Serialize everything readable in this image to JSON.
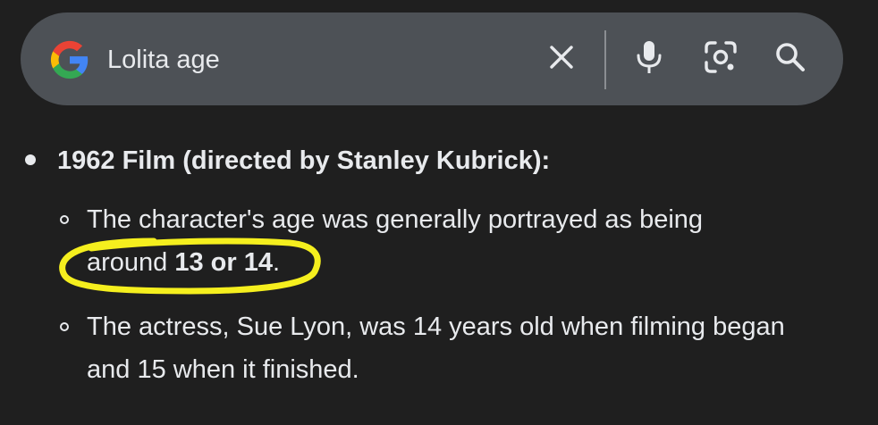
{
  "search": {
    "query": "Lolita age",
    "icons": {
      "logo": "google-g-logo",
      "clear": "close-icon",
      "voice": "microphone-icon",
      "lens": "camera-lens-icon",
      "submit": "search-icon"
    }
  },
  "result": {
    "heading": "1962 Film (directed by Stanley Kubrick):",
    "items": [
      {
        "line1": "The character's age was generally portrayed as being",
        "line2_prefix": "around ",
        "line2_bold": "13 or 14",
        "line2_suffix": "."
      },
      {
        "line1": "The actress, Sue Lyon, was 14 years old when filming began",
        "line2": "and 15 when it finished."
      }
    ]
  },
  "colors": {
    "background": "#1f1f1f",
    "search_bar": "#4d5156",
    "text": "#e8eaed",
    "annotation": "#f5ef1e"
  }
}
